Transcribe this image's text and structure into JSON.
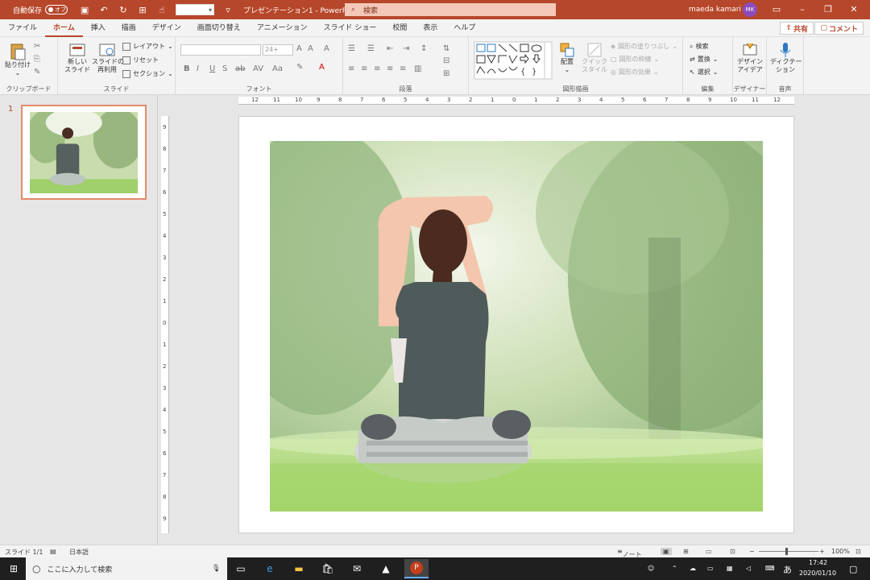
{
  "titlebar": {
    "autosave_label": "自動保存",
    "autosave_state": "オフ",
    "doc_title": "プレゼンテーション1  -  PowerPo...",
    "search_label": "検索",
    "user_name": "maeda kamari",
    "user_initials": "MK"
  },
  "tabs": [
    "ファイル",
    "ホーム",
    "挿入",
    "描画",
    "デザイン",
    "画面切り替え",
    "アニメーション",
    "スライド ショー",
    "校閲",
    "表示",
    "ヘルプ"
  ],
  "share_label": "共有",
  "comment_label": "コメント",
  "ribbon": {
    "clipboard": {
      "paste": "貼り付け",
      "label": "クリップボード"
    },
    "slides": {
      "new_slide": "新しい\nスライド",
      "reuse": "スライドの\n再利用",
      "layout": "レイアウト",
      "reset": "リセット",
      "section": "セクション",
      "label": "スライド"
    },
    "font": {
      "size": "24+",
      "label": "フォント"
    },
    "paragraph": {
      "label": "段落"
    },
    "drawing": {
      "arrange": "配置",
      "quick_style": "クイック\nスタイル",
      "fill": "図形の塗りつぶし",
      "outline": "図形の枠線",
      "effects": "図形の効果",
      "label": "図形描画"
    },
    "editing": {
      "find": "検索",
      "replace": "置換",
      "select": "選択",
      "label": "編集"
    },
    "designer": {
      "ideas": "デザイン\nアイデア",
      "label": "デザイナー"
    },
    "voice": {
      "dictate": "ディクテー\nション",
      "label": "音声"
    }
  },
  "thumbnail": {
    "number": "1"
  },
  "hruler_labels": [
    "12",
    "11",
    "10",
    "9",
    "8",
    "7",
    "6",
    "5",
    "4",
    "3",
    "2",
    "1",
    "0",
    "1",
    "2",
    "3",
    "4",
    "5",
    "6",
    "7",
    "8",
    "9",
    "10",
    "11",
    "12"
  ],
  "vruler_labels": [
    "9",
    "8",
    "7",
    "6",
    "5",
    "4",
    "3",
    "2",
    "1",
    "0",
    "1",
    "2",
    "3",
    "4",
    "5",
    "6",
    "7",
    "8",
    "9"
  ],
  "statusbar": {
    "slide_info": "スライド 1/1",
    "language": "日本語",
    "notes": "ノート",
    "zoom": "100%"
  },
  "taskbar": {
    "search_placeholder": "ここに入力して検索",
    "time": "17:42",
    "date": "2020/01/10",
    "ime": "あ"
  }
}
